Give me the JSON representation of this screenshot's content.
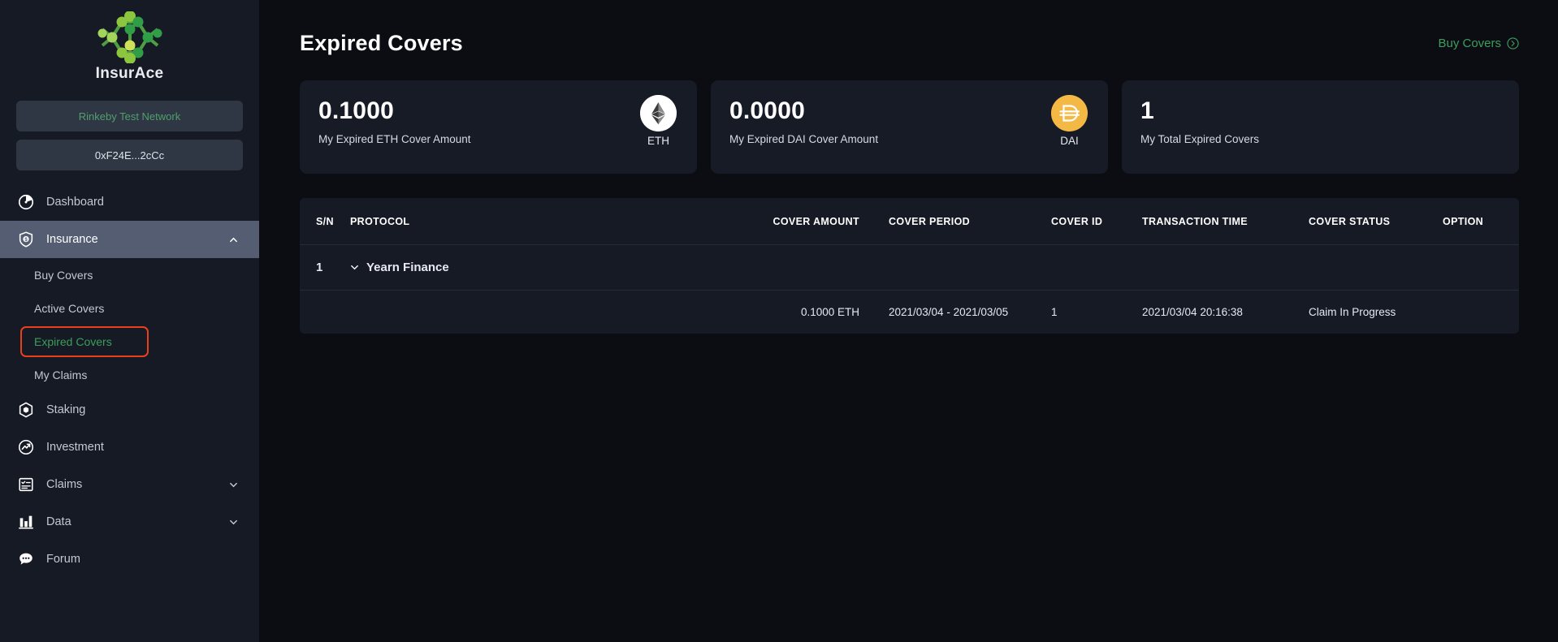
{
  "sidebar": {
    "brand": {
      "name": "InsurAce",
      "logo_icon": "insurace-molecule-logo"
    },
    "network_pill": "Rinkeby Test Network",
    "address_pill": "0xF24E...2cCc",
    "items": [
      {
        "label": "Dashboard",
        "icon": "pie-chart-icon",
        "active": false,
        "expandable": false
      },
      {
        "label": "Insurance",
        "icon": "shield-dollar-icon",
        "active": true,
        "expandable": true,
        "expanded": true
      },
      {
        "label": "Staking",
        "icon": "hexagon-cube-icon",
        "active": false,
        "expandable": false
      },
      {
        "label": "Investment",
        "icon": "trend-circle-icon",
        "active": false,
        "expandable": false
      },
      {
        "label": "Claims",
        "icon": "clipboard-list-icon",
        "active": false,
        "expandable": true,
        "expanded": false
      },
      {
        "label": "Data",
        "icon": "bar-chart-icon",
        "active": false,
        "expandable": true,
        "expanded": false
      },
      {
        "label": "Forum",
        "icon": "chat-bubble-icon",
        "active": false,
        "expandable": false
      }
    ],
    "insurance_subitems": [
      {
        "label": "Buy Covers",
        "selected": false
      },
      {
        "label": "Active Covers",
        "selected": false
      },
      {
        "label": "Expired Covers",
        "selected": true
      },
      {
        "label": "My Claims",
        "selected": false
      }
    ],
    "highlight_color": "#e8401c",
    "selected_color": "#3d9e5c"
  },
  "header": {
    "title": "Expired Covers",
    "buy_covers_label": "Buy Covers",
    "buy_covers_icon": "arrow-right-circle-icon"
  },
  "cards": [
    {
      "value": "0.1000",
      "label": "My Expired ETH Cover Amount",
      "ticker": "ETH",
      "coin_icon": "ethereum-icon",
      "coin_color": "#ffffff"
    },
    {
      "value": "0.0000",
      "label": "My Expired DAI Cover Amount",
      "ticker": "DAI",
      "coin_icon": "dai-icon",
      "coin_color": "#f4b844"
    },
    {
      "value": "1",
      "label": "My Total Expired Covers",
      "ticker": "",
      "coin_icon": "",
      "coin_color": ""
    }
  ],
  "table": {
    "columns": [
      {
        "key": "sn",
        "label": "S/N"
      },
      {
        "key": "proto",
        "label": "PROTOCOL"
      },
      {
        "key": "amount",
        "label": "COVER AMOUNT"
      },
      {
        "key": "period",
        "label": "COVER PERIOD"
      },
      {
        "key": "id",
        "label": "COVER ID"
      },
      {
        "key": "time",
        "label": "TRANSACTION TIME"
      },
      {
        "key": "status",
        "label": "COVER STATUS"
      },
      {
        "key": "option",
        "label": "OPTION"
      }
    ],
    "group": {
      "sn": "1",
      "protocol": "Yearn Finance",
      "chevron_icon": "chevron-down-icon"
    },
    "row": {
      "amount": "0.1000 ETH",
      "period": "2021/03/04 - 2021/03/05",
      "id": "1",
      "time": "2021/03/04 20:16:38",
      "status": "Claim In Progress",
      "option": ""
    }
  }
}
